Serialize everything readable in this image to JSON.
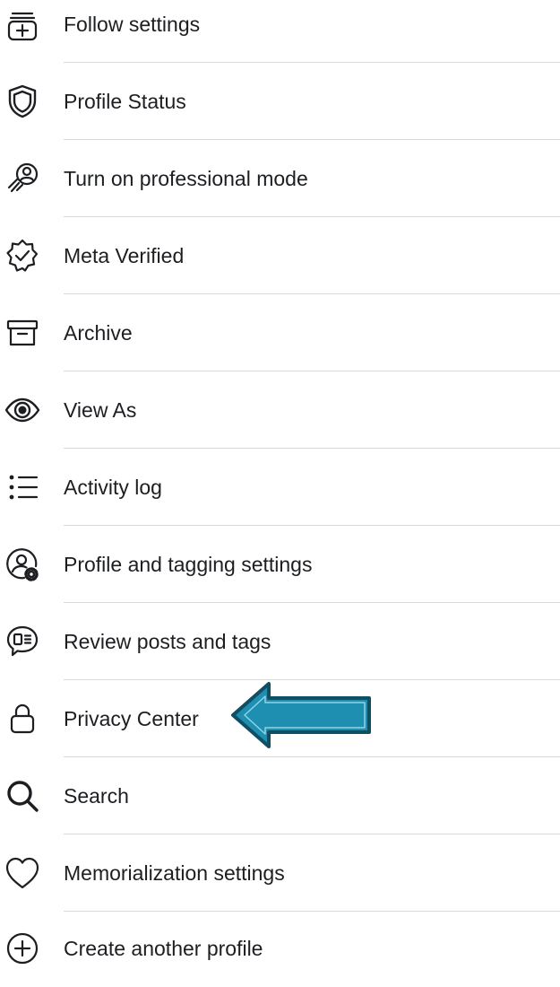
{
  "menu": {
    "items": [
      {
        "label": "Follow settings",
        "icon": "follow-settings-icon"
      },
      {
        "label": "Profile Status",
        "icon": "shield-icon"
      },
      {
        "label": "Turn on professional mode",
        "icon": "professional-mode-icon"
      },
      {
        "label": "Meta Verified",
        "icon": "verified-badge-icon"
      },
      {
        "label": "Archive",
        "icon": "archive-box-icon"
      },
      {
        "label": "View As",
        "icon": "eye-icon"
      },
      {
        "label": "Activity log",
        "icon": "list-icon"
      },
      {
        "label": "Profile and tagging settings",
        "icon": "profile-gear-icon"
      },
      {
        "label": "Review posts and tags",
        "icon": "speech-bubble-icon"
      },
      {
        "label": "Privacy Center",
        "icon": "lock-icon"
      },
      {
        "label": "Search",
        "icon": "search-icon"
      },
      {
        "label": "Memorialization settings",
        "icon": "heart-icon"
      },
      {
        "label": "Create another profile",
        "icon": "plus-circle-icon"
      }
    ]
  },
  "annotation": {
    "arrow_color": "#1e8fb0",
    "arrow_border_color": "#0f4f66",
    "points_to": "Privacy Center"
  },
  "colors": {
    "text": "#1c1e21",
    "divider": "#d9d9d9",
    "background": "#ffffff"
  }
}
